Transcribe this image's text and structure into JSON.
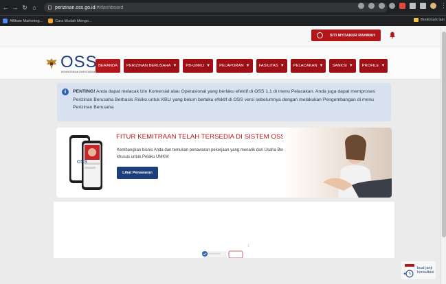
{
  "browser": {
    "url_host": "perizinan.oss.go.id",
    "url_path": "/#/dashboard",
    "bookmarks": [
      {
        "label": "Affiliate Marketing...",
        "color": "#4c8bf5"
      },
      {
        "label": "Cara Mudah Mengo...",
        "color": "#f4a62a"
      }
    ],
    "bookmarks_folder": "Bookmark lain"
  },
  "header": {
    "user_name": "SITI MYDANUR RAHMAH"
  },
  "logo": {
    "text": "OSS",
    "subtext": "KEMENTERIAN INVESTASI/BKPM"
  },
  "menu": [
    {
      "label": "BERANDA",
      "dropdown": false
    },
    {
      "label": "PERIZINAN BERUSAHA",
      "dropdown": true
    },
    {
      "label": "PB-UMKU",
      "dropdown": true
    },
    {
      "label": "PELAPORAN",
      "dropdown": true
    },
    {
      "label": "FASILITAS",
      "dropdown": true
    },
    {
      "label": "PELACAKAN",
      "dropdown": true
    },
    {
      "label": "SANKSI",
      "dropdown": true
    },
    {
      "label": "PROFILE",
      "dropdown": true
    }
  ],
  "notice": {
    "bold": "PENTING!",
    "text": " Anda dapat melacak Izin Komersial atau Operasional yang berlaku efektif di OSS 1.1 di menu Pelacakan. Anda juga dapat memproses Perizinan Berusaha Berbasis Risiko untuk KBLI yang belum berlaku efektif di OSS versi sebelumnya dengan melakukan Pengembangan di menu Perizinan Berusaha"
  },
  "banner": {
    "title": "FITUR KEMITRAAN TELAH TERSEDIA DI SISTEM OSS",
    "description": "Kembangkan bisnis Anda dan temukan penawaran pekerjaan yang menarik dari Usaha Besar khusus untuk Pelaku UMKM",
    "button": "Lihat Penawaran",
    "phone_logo": "OSS"
  },
  "consultation": {
    "line1": "buat janji",
    "line2": "konsultasi"
  },
  "colors": {
    "brand_red": "#b4151b",
    "brand_navy": "#1e3e7b",
    "notice_bg": "#d7e1ef"
  }
}
